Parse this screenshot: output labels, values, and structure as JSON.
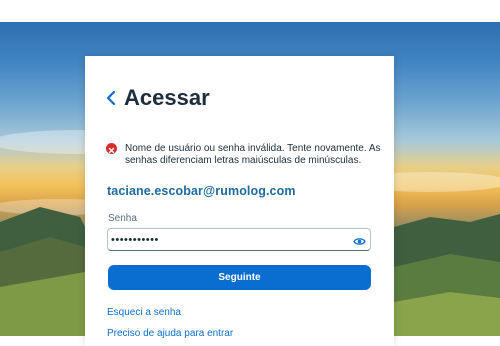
{
  "login": {
    "title": "Acessar",
    "error_message": "Nome de usuário ou senha inválida. Tente novamente. As senhas diferenciam letras maiúsculas de minúsculas.",
    "user_email": "taciane.escobar@rumolog.com",
    "password_label": "Senha",
    "password_value": "•••••••••••",
    "continue_label": "Seguinte",
    "forgot_password_label": "Esqueci a senha",
    "need_help_label": "Preciso de ajuda para entrar"
  },
  "icons": {
    "back": "chevron-left-icon",
    "error": "error-icon",
    "show_password": "eye-icon"
  },
  "colors": {
    "primary": "#0a6ed1",
    "error": "#d92c2c",
    "text": "#1d2d3e",
    "email": "#1d6aa0"
  }
}
